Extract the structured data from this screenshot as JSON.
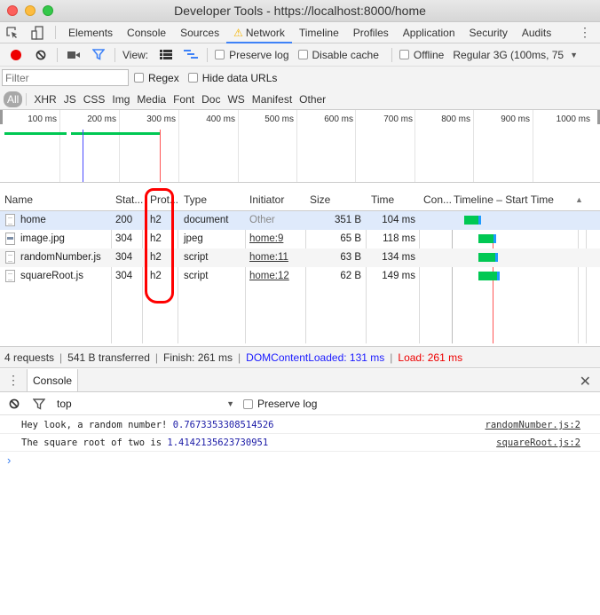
{
  "window": {
    "title": "Developer Tools - https://localhost:8000/home"
  },
  "tabs": [
    {
      "label": "Elements"
    },
    {
      "label": "Console"
    },
    {
      "label": "Sources"
    },
    {
      "label": "Network",
      "active": true,
      "warning": true
    },
    {
      "label": "Timeline"
    },
    {
      "label": "Profiles"
    },
    {
      "label": "Application"
    },
    {
      "label": "Security"
    },
    {
      "label": "Audits"
    }
  ],
  "toolbar": {
    "view_label": "View:",
    "preserve_log": "Preserve log",
    "disable_cache": "Disable cache",
    "offline": "Offline",
    "throttle": "Regular 3G (100ms, 75"
  },
  "filter": {
    "placeholder": "Filter",
    "regex": "Regex",
    "hide_data_urls": "Hide data URLs",
    "types": [
      "All",
      "XHR",
      "JS",
      "CSS",
      "Img",
      "Media",
      "Font",
      "Doc",
      "WS",
      "Manifest",
      "Other"
    ]
  },
  "overview": {
    "ticks": [
      "100 ms",
      "200 ms",
      "300 ms",
      "400 ms",
      "500 ms",
      "600 ms",
      "700 ms",
      "800 ms",
      "900 ms",
      "1000 ms"
    ]
  },
  "grid": {
    "headers": {
      "name": "Name",
      "status": "Stat...",
      "protocol": "Prot...",
      "type": "Type",
      "initiator": "Initiator",
      "size": "Size",
      "time": "Time",
      "connection": "Con...",
      "timeline": "Timeline – Start Time"
    },
    "rows": [
      {
        "name": "home",
        "status": "200",
        "protocol": "h2",
        "type": "document",
        "initiator": "Other",
        "size": "351 B",
        "time": "104 ms",
        "icon": "document-icon"
      },
      {
        "name": "image.jpg",
        "status": "304",
        "protocol": "h2",
        "type": "jpeg",
        "initiator": "home:9",
        "size": "65 B",
        "time": "118 ms",
        "icon": "image-icon"
      },
      {
        "name": "randomNumber.js",
        "status": "304",
        "protocol": "h2",
        "type": "script",
        "initiator": "home:11",
        "size": "63 B",
        "time": "134 ms",
        "icon": "script-icon"
      },
      {
        "name": "squareRoot.js",
        "status": "304",
        "protocol": "h2",
        "type": "script",
        "initiator": "home:12",
        "size": "62 B",
        "time": "149 ms",
        "icon": "script-icon"
      }
    ]
  },
  "status": {
    "requests": "4 requests",
    "transferred": "541 B transferred",
    "finish": "Finish: 261 ms",
    "dom_content_loaded": "DOMContentLoaded: 131 ms",
    "load": "Load: 261 ms"
  },
  "drawer": {
    "tab": "Console",
    "context": "top",
    "preserve_log": "Preserve log"
  },
  "console": {
    "messages": [
      {
        "text": "Hey look, a random number! ",
        "value": "0.7673353308514526",
        "source": "randomNumber.js:2"
      },
      {
        "text": "The square root of two is ",
        "value": "1.4142135623730951",
        "source": "squareRoot.js:2"
      }
    ],
    "prompt": "›"
  },
  "colors": {
    "accent": "#3e82f7",
    "record": "#ee0000",
    "dcl": "#1a1aff",
    "load": "#ee0000",
    "waiting": "#00c853",
    "download": "#1e9bff"
  }
}
